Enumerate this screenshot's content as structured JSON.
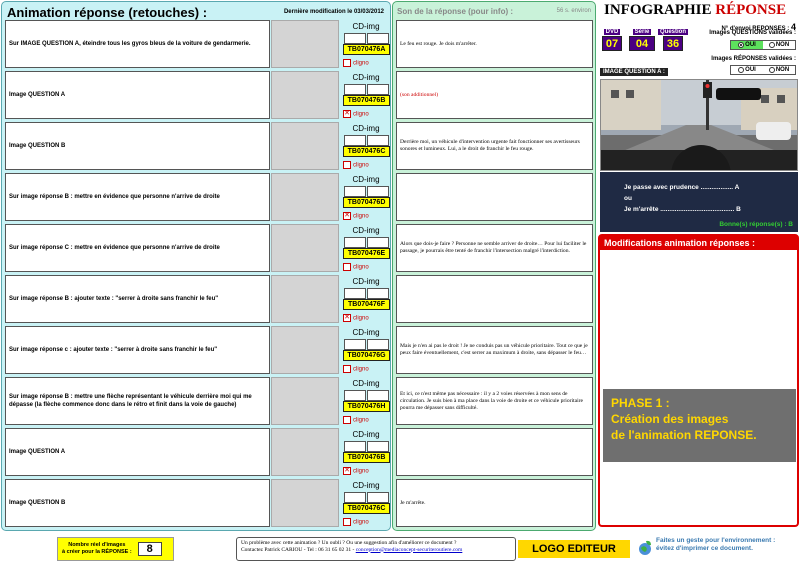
{
  "left": {
    "title": "Animation réponse (retouches) :",
    "date": "Dernière modification le 03/03/2012"
  },
  "rows": [
    {
      "desc": "Sur IMAGE QUESTION A, éteindre tous les gyros bleus de la voiture de gendarmerie.",
      "code": "TB070476A",
      "blink_checked": false
    },
    {
      "desc": "Image QUESTION A",
      "code": "TB070476B",
      "blink_checked": true
    },
    {
      "desc": "Image QUESTION B",
      "code": "TB070476C",
      "blink_checked": false
    },
    {
      "desc": "Sur image réponse B : mettre en évidence que personne n'arrive de droite",
      "code": "TB070476D",
      "blink_checked": true
    },
    {
      "desc": "Sur image réponse C : mettre en évidence que personne n'arrive de droite",
      "code": "TB070476E",
      "blink_checked": false
    },
    {
      "desc": "Sur image réponse B : ajouter texte : \"serrer à droite sans franchir le feu\"",
      "code": "TB070476F",
      "blink_checked": true
    },
    {
      "desc": "Sur image réponse c : ajouter texte : \"serrer à droite sans franchir le feu\"",
      "code": "TB070476G",
      "blink_checked": false
    },
    {
      "desc": "Sur image réponse B : mettre une flèche représentant le véhicule derrière moi qui me dépasse (la flèche commence donc dans le rétro et finit dans la voie de gauche)",
      "code": "TB070476H",
      "blink_checked": false
    },
    {
      "desc": "Image QUESTION A",
      "code": "TB070476B",
      "blink_checked": true
    },
    {
      "desc": "Image QUESTION B",
      "code": "TB070476C",
      "blink_checked": false
    }
  ],
  "labels": {
    "cd_img": "CD-img",
    "blink": "cligno"
  },
  "mid": {
    "title": "Son de la réponse (pour info) :",
    "duration": "56 s. environ",
    "sounds": [
      "Le feu est rouge. Je dois m'arrêter.",
      "(son additionnel)",
      "Derrière moi, un véhicule d'intervention urgente fait fonctionner ses avertisseurs sonores et lumineux. Lui, a le droit de franchir le feu rouge.",
      "",
      "Alors que dois-je faire ? Personne ne semble arriver de droite… Pour lui faciliter le passage, je pourrais être tenté de franchir l'intersection malgré l'interdiction.",
      "",
      "Mais je n'en ai pas le droit ! Je ne conduis pas un véhicule prioritaire. Tout ce que je peux faire éventuellement, c'est serrer au maximum à droite, sans dépasser le feu…",
      "Et ici, ce n'est même pas nécessaire : il y a 2 voies réservées à mon sens de circulation. Je suis bien à ma place dans la voie de droite et ce véhicule prioritaire pourra me dépasser sans difficulté.",
      "",
      "Je m'arrête."
    ]
  },
  "right": {
    "title_a": "INFOGRAPHIE ",
    "title_b": "RÉPONSE",
    "envoi_label": "N° d'envoi REPONSES :",
    "envoi_num": "4",
    "dvd_label": "DVD",
    "dvd": "07",
    "serie_label": "Série",
    "serie": "04",
    "question_label": "Question",
    "question": "36",
    "val_q_label": "Images QUESTIONS validées :",
    "val_r_label": "Images RÉPONSES validées :",
    "oui": "OUI",
    "non": "NON",
    "img_q_label": "IMAGE QUESTION A :",
    "ans1": "Je passe avec prudence .................. A",
    "ans2": "ou",
    "ans3": "Je m'arrête ......................................... B",
    "good": "Bonne(s) réponse(s) :     B",
    "mod_title": "Modifications animation réponses :",
    "phase1": "PHASE 1 :",
    "phase2": "Création des images",
    "phase3": "de l'animation REPONSE."
  },
  "footer": {
    "count_label1": "Nombre réel d'images",
    "count_label2": "à créer pour la RÉPONSE :",
    "count": "8",
    "contact1": "Un problème avec cette animation ? Un oubli ? Ou une suggestion afin d'améliorer ce document ?",
    "contact2": "Contactez Patrick CARIOU - Tel : 06 31 65 02 31 -",
    "mail": "conception@mediaconcept-securiteroutiere.com",
    "logo": "LOGO EDITEUR",
    "env1": "Faites un geste pour l'environnement :",
    "env2": "évitez d'imprimer ce document."
  }
}
